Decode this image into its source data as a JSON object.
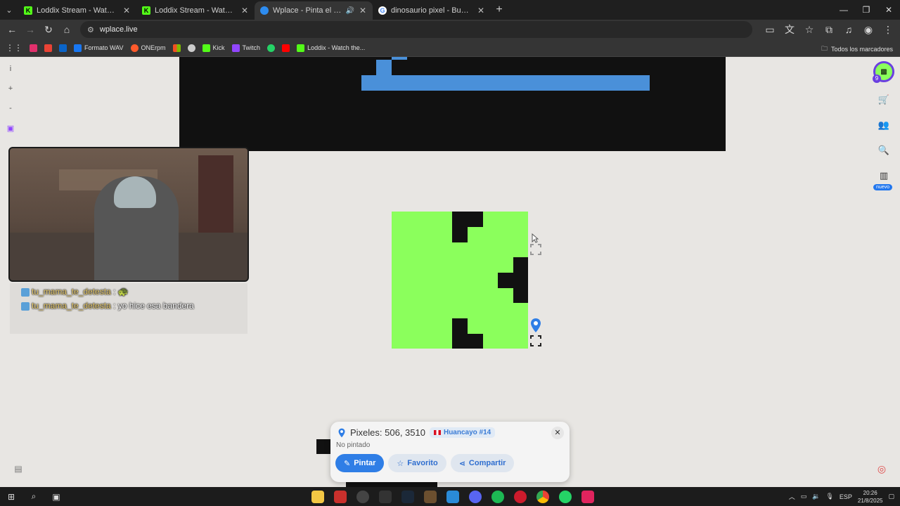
{
  "tabs": [
    {
      "title": "Loddix Stream - Watch Live on Kick",
      "favicon": "kick-icon",
      "active": false
    },
    {
      "title": "Loddix Stream - Watch Live on Kick",
      "favicon": "kick-icon",
      "active": false
    },
    {
      "title": "Wplace - Pinta el mundo",
      "favicon": "wplace-icon",
      "active": true
    },
    {
      "title": "dinosaurio pixel - Buscar con Google",
      "favicon": "google-icon",
      "active": false
    }
  ],
  "address": {
    "url": "wplace.live"
  },
  "bookmarks": {
    "items": [
      "Formato WAV",
      "ONErpm",
      "Kick",
      "Twitch",
      "Loddix - Watch the..."
    ],
    "all_label": "Todos los marcadores"
  },
  "chat": {
    "messages": [
      {
        "user": "tu_mama_te_detesta",
        "text": ": 🐢"
      },
      {
        "user": "tu_mama_te_detesta",
        "text": ": yo hice esa bandera"
      }
    ]
  },
  "sidebar": {
    "level": "9",
    "new_badge": "nuevo"
  },
  "pixel_info": {
    "coords": "Pixeles: 506, 3510",
    "region": "Huancayo #14",
    "status": "No pintado",
    "paint_label": "Pintar",
    "favorite_label": "Favorito",
    "share_label": "Compartir"
  },
  "taskbar": {
    "lang": "ESP",
    "time": "20:26",
    "date": "21/8/2025"
  },
  "colors": {
    "green": "#8bff5c",
    "blue": "#4a90d9",
    "primary": "#2f7ee6"
  }
}
